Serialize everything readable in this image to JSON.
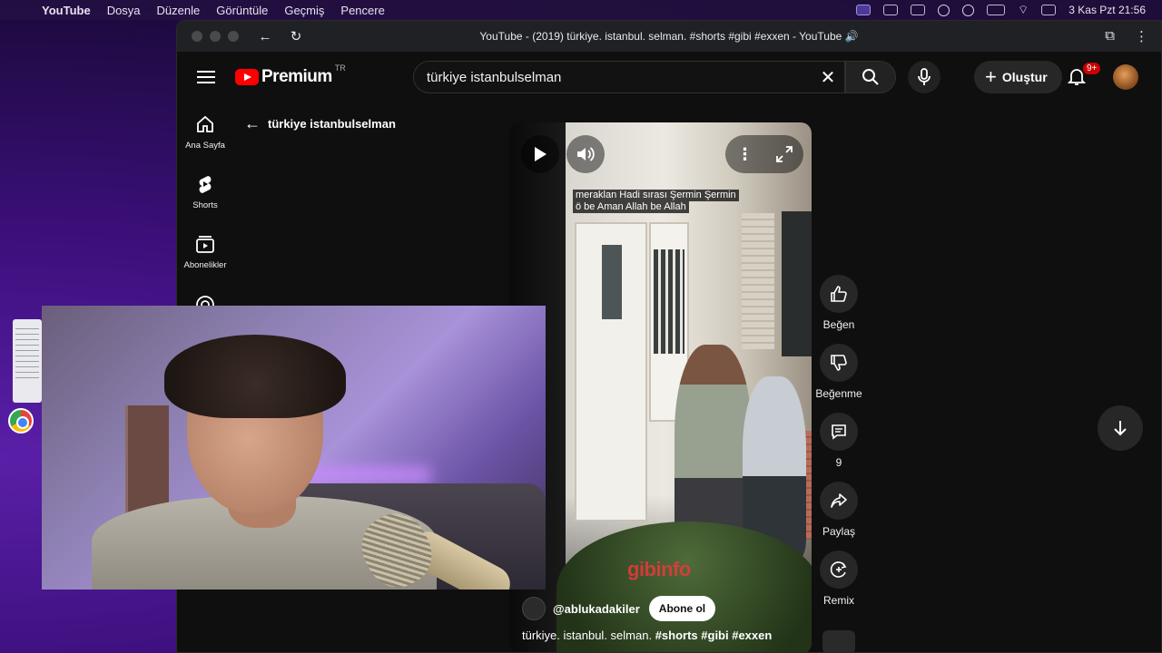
{
  "menubar": {
    "app_name": "YouTube",
    "menus": [
      "Dosya",
      "Düzenle",
      "Görüntüle",
      "Geçmiş",
      "Pencere"
    ],
    "datetime": "3 Kas Pzt  21:56"
  },
  "browser": {
    "window_title": "YouTube - (2019) türkiye. istanbul. selman. #shorts #gibi #exxen - YouTube 🔊"
  },
  "header": {
    "brand": "Premium",
    "region": "TR",
    "search_query": "türkiye  istanbulselman",
    "create_label": "Oluştur",
    "notifications_badge": "9+"
  },
  "sidebar": {
    "items": [
      {
        "label": "Ana Sayfa",
        "icon": "home-icon"
      },
      {
        "label": "Shorts",
        "icon": "shorts-icon"
      },
      {
        "label": "Abonelikler",
        "icon": "subscriptions-icon"
      }
    ]
  },
  "back_title": "türkiye istanbulselman",
  "video": {
    "caption_line1": "meraklan Hadi sırası Şermin Şermin",
    "caption_line2": "ö be Aman Allah be Allah",
    "watermark": "gibinfo",
    "channel": "@ablukadakiler",
    "subscribe_label": "Abone ol",
    "title_plain": "türkiye. istanbul. selman.",
    "title_tags": "#shorts #gibi #exxen"
  },
  "actions": {
    "like": "Beğen",
    "dislike": "Beğenme",
    "comments": "9",
    "share": "Paylaş",
    "remix": "Remix"
  }
}
